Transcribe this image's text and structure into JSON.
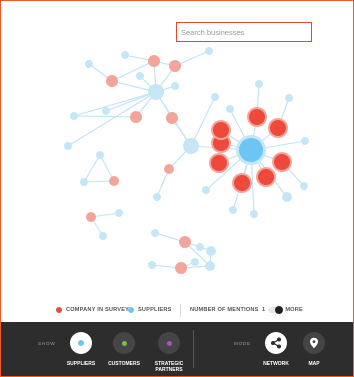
{
  "search": {
    "placeholder": "Search businesses"
  },
  "legend": {
    "company_label": "COMPANY IN SURVEY",
    "suppliers_label": "SUPPLIERS",
    "mentions_label": "NUMBER OF MENTIONS",
    "scale_min": "1",
    "scale_max": "MORE"
  },
  "colors": {
    "company": "#ee4a3b",
    "company_light": "#f4a59b",
    "supplier": "#6cc6f3",
    "supplier_light": "#c5e6f7",
    "edge": "#bfe2f6",
    "customers": "#7ac143",
    "strategic": "#b04fc2",
    "accent_border": "#f05a28"
  },
  "show": {
    "label": "SHOW",
    "buttons": [
      {
        "label": "SUPPLIERS",
        "icon": "dot-icon",
        "active": true
      },
      {
        "label": "CUSTOMERS",
        "icon": "dot-icon",
        "active": false
      },
      {
        "label": "STRATEGIC PARTNERS",
        "icon": "dot-icon",
        "active": false
      }
    ]
  },
  "mode": {
    "label": "MODE",
    "buttons": [
      {
        "label": "NETWORK",
        "icon": "share-icon",
        "active": true
      },
      {
        "label": "MAP",
        "icon": "map-pin-icon",
        "active": false
      }
    ]
  }
}
